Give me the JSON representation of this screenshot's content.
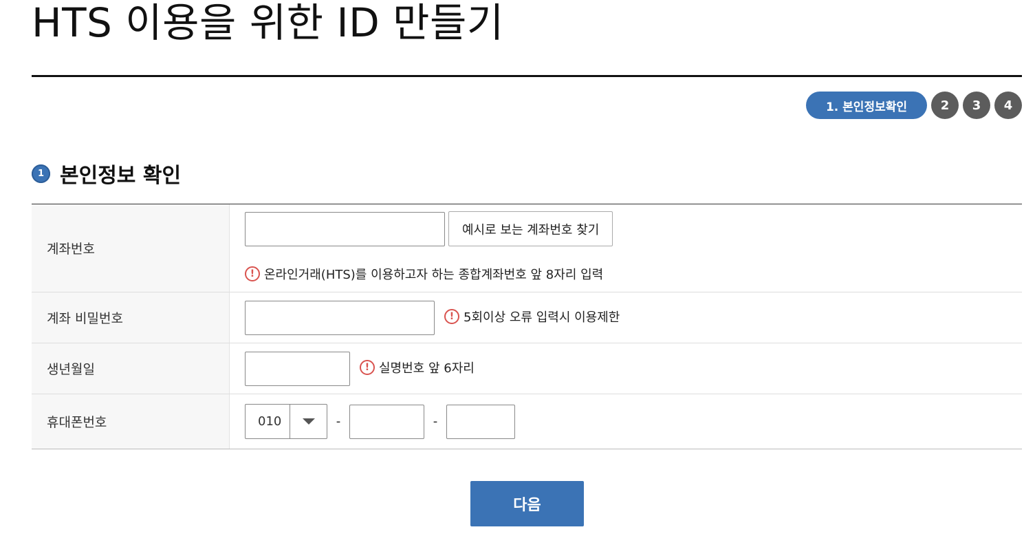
{
  "page": {
    "title": "HTS 이용을 위한 ID 만들기"
  },
  "steps": {
    "active_label": "1. 본인정보확인",
    "others": [
      "2",
      "3",
      "4"
    ]
  },
  "section": {
    "number": "1",
    "title": "본인정보 확인"
  },
  "form": {
    "account_number": {
      "label": "계좌번호",
      "value": "",
      "example_button": "예시로 보는 계좌번호 찾기",
      "notice": "온라인거래(HTS)를 이용하고자 하는 종합계좌번호 앞 8자리 입력"
    },
    "account_password": {
      "label": "계좌 비밀번호",
      "value": "",
      "notice": "5회이상 오류 입력시 이용제한"
    },
    "birth_date": {
      "label": "생년월일",
      "value": "",
      "notice": "실명번호 앞 6자리"
    },
    "phone": {
      "label": "휴대폰번호",
      "prefix_selected": "010",
      "separator": "-",
      "middle": "",
      "last": ""
    }
  },
  "actions": {
    "next_label": "다음"
  },
  "colors": {
    "accent": "#3b73b5",
    "step_inactive": "#5c5c5c",
    "warning": "#d9534f"
  },
  "icons": {
    "warning": "exclamation-circle-icon",
    "dropdown": "caret-down-icon"
  }
}
